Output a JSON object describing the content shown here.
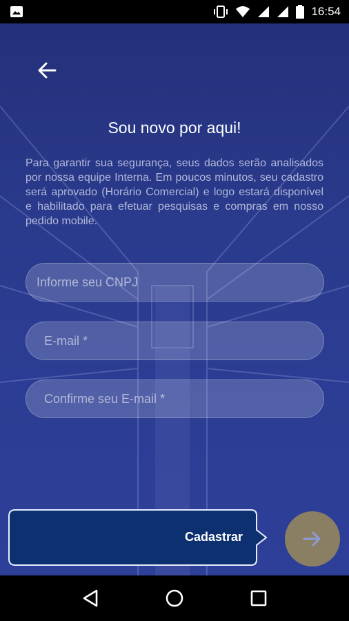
{
  "status_bar": {
    "time": "16:54",
    "icons": [
      "image-icon",
      "vibrate-icon",
      "wifi-icon",
      "signal-icon",
      "signal-icon",
      "battery-icon"
    ]
  },
  "header": {
    "back_icon": "arrow-left-icon",
    "title": "Sou novo por aqui!"
  },
  "description": "Para garantir sua segurança, seus dados serão analisados por nossa equipe Interna. Em poucos minutos, seu cadastro será aprovado (Horário Comercial) e logo estará disponível e habilitado para efetuar pesquisas e compras em nosso pedido mobile.",
  "form": {
    "cnpj_placeholder": "Informe seu CNPJ",
    "email_placeholder": "E-mail *",
    "confirm_email_placeholder": "Confirme seu E-mail *"
  },
  "actions": {
    "submit_label": "Cadastrar",
    "next_icon": "arrow-right-icon"
  },
  "nav_bar": {
    "icons": [
      "back-triangle-icon",
      "home-circle-icon",
      "recents-square-icon"
    ]
  },
  "colors": {
    "background": "#2a3a8c",
    "submit_button": "#0d3170",
    "next_button": "#8a7f62"
  }
}
